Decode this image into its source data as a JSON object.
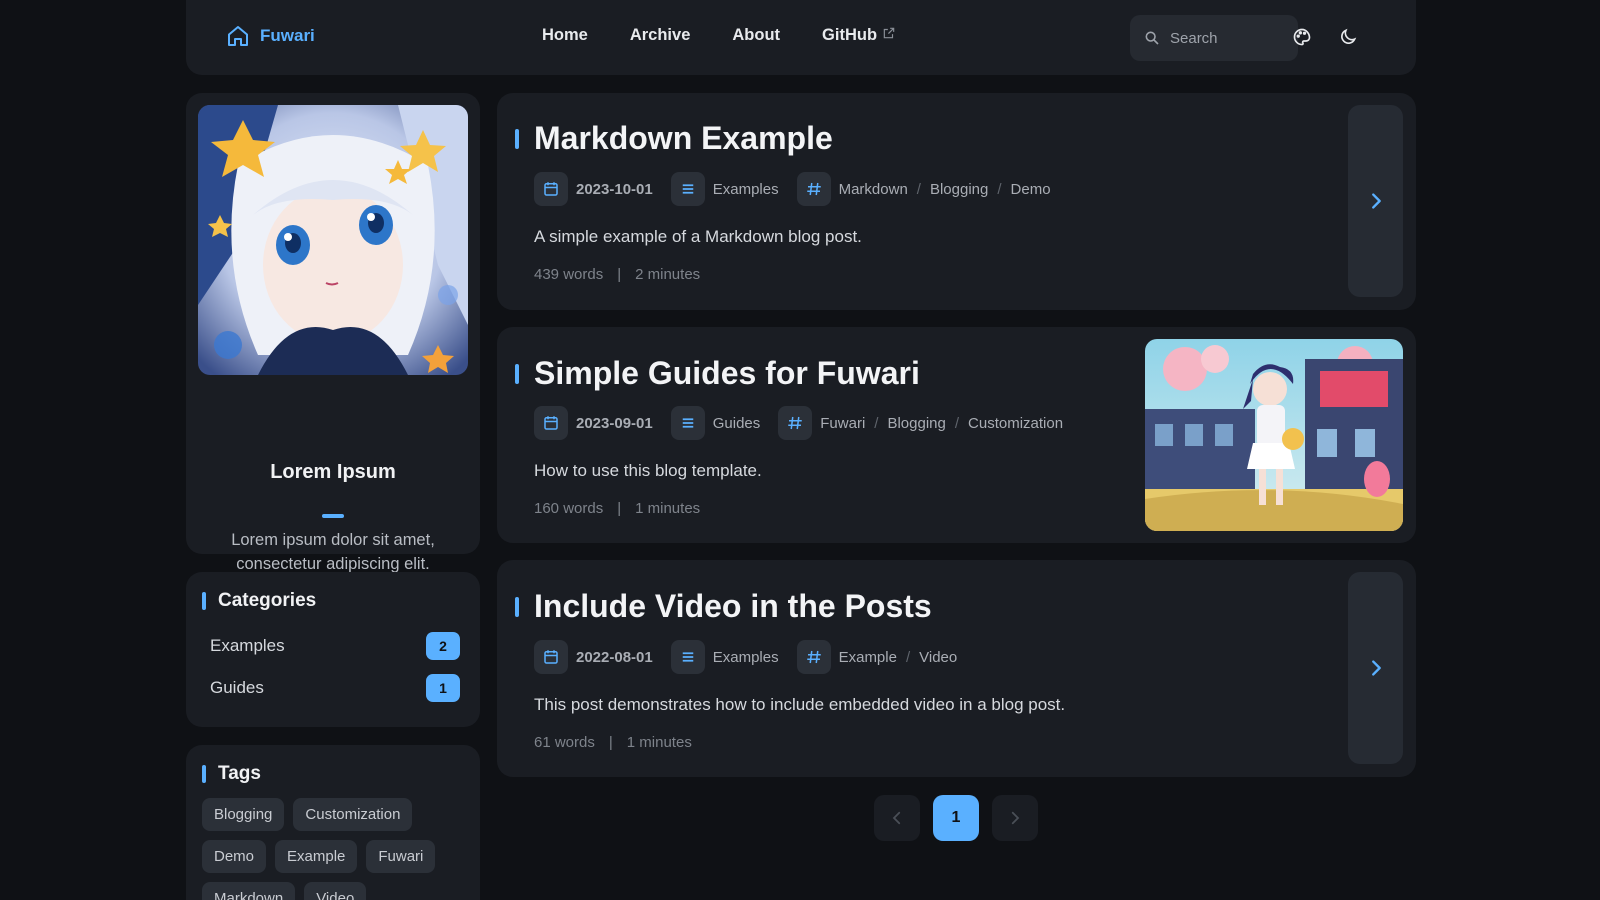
{
  "nav": {
    "brand": "Fuwari",
    "links": [
      {
        "label": "Home"
      },
      {
        "label": "Archive"
      },
      {
        "label": "About"
      },
      {
        "label": "GitHub",
        "external": true
      }
    ],
    "search_placeholder": "Search",
    "icons": [
      "home-icon",
      "search-icon",
      "palette-icon",
      "moon-icon"
    ]
  },
  "profile": {
    "name": "Lorem Ipsum",
    "bio": "Lorem ipsum dolor sit amet, consectetur adipiscing elit.",
    "socials": [
      "twitter-icon",
      "steam-icon",
      "github-icon"
    ]
  },
  "categories": {
    "title": "Categories",
    "items": [
      {
        "label": "Examples",
        "count": "2"
      },
      {
        "label": "Guides",
        "count": "1"
      }
    ]
  },
  "tags": {
    "title": "Tags",
    "items": [
      "Blogging",
      "Customization",
      "Demo",
      "Example",
      "Fuwari",
      "Markdown",
      "Video"
    ]
  },
  "posts": [
    {
      "title": "Markdown Example",
      "date": "2023-10-01",
      "category": "Examples",
      "tags": [
        "Markdown",
        "Blogging",
        "Demo"
      ],
      "description": "A simple example of a Markdown blog post.",
      "words": "439 words",
      "time": "2 minutes",
      "separator": "|"
    },
    {
      "title": "Simple Guides for Fuwari",
      "date": "2023-09-01",
      "category": "Guides",
      "tags": [
        "Fuwari",
        "Blogging",
        "Customization"
      ],
      "description": "How to use this blog template.",
      "words": "160 words",
      "time": "1 minutes",
      "separator": "|"
    },
    {
      "title": "Include Video in the Posts",
      "date": "2022-08-01",
      "category": "Examples",
      "tags": [
        "Example",
        "Video"
      ],
      "description": "This post demonstrates how to include embedded video in a blog post.",
      "words": "61 words",
      "time": "1 minutes",
      "separator": "|"
    }
  ],
  "pagination": {
    "current": "1"
  },
  "colors": {
    "accent": "#5ab0ff",
    "bg": "#0f1115",
    "card": "#1a1d23"
  }
}
